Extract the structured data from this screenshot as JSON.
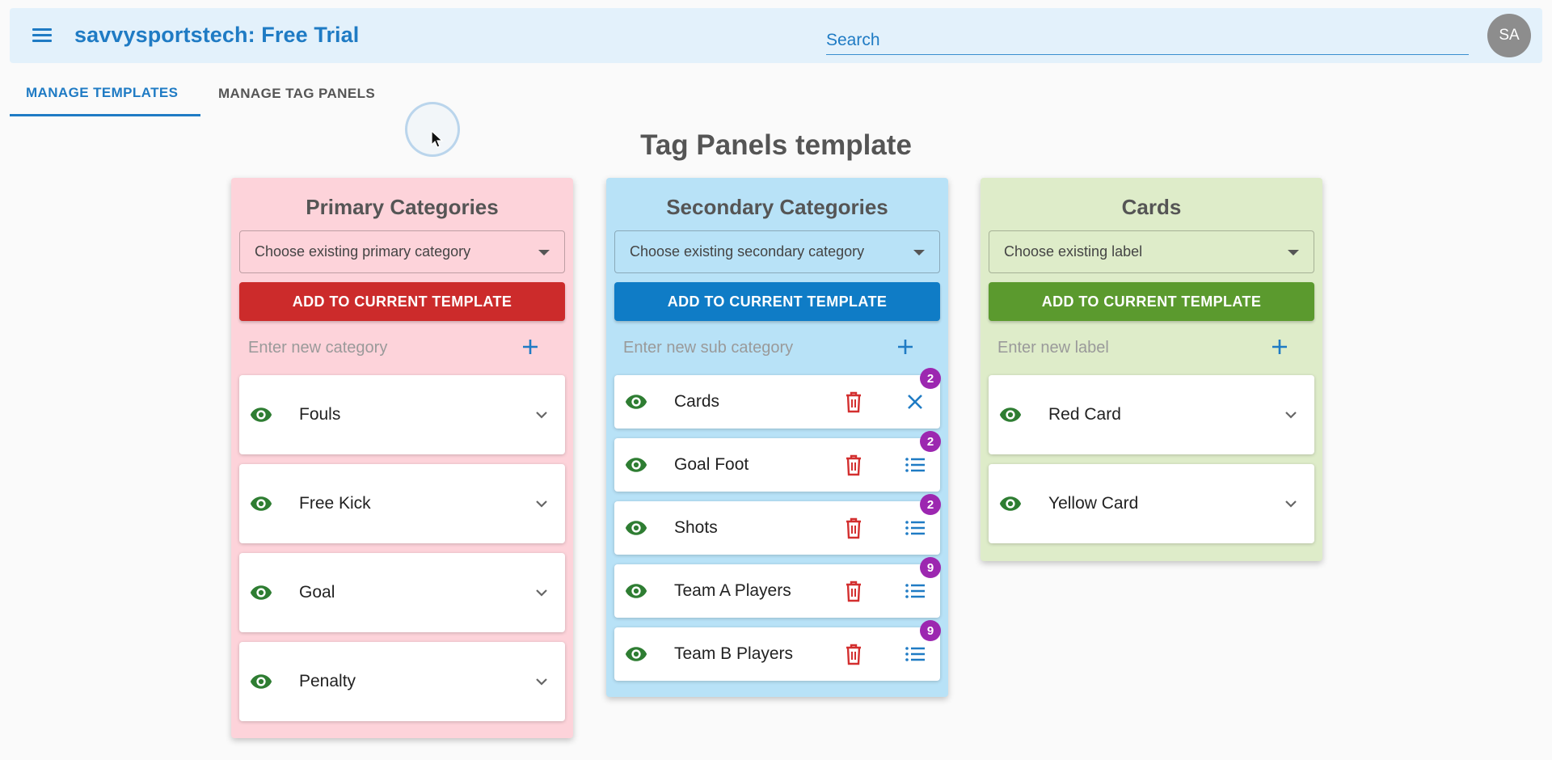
{
  "header": {
    "app_title": "savvysportstech: Free Trial",
    "search_placeholder": "Search",
    "avatar_initials": "SA"
  },
  "tabs": [
    {
      "label": "MANAGE TEMPLATES",
      "active": true
    },
    {
      "label": "MANAGE TAG PANELS",
      "active": false
    }
  ],
  "page_title": "Tag Panels template",
  "panels": {
    "primary": {
      "title": "Primary Categories",
      "select_value": "Choose existing primary category",
      "add_button": "ADD TO CURRENT TEMPLATE",
      "new_placeholder": "Enter new category",
      "items": [
        {
          "label": "Fouls"
        },
        {
          "label": "Free Kick"
        },
        {
          "label": "Goal"
        },
        {
          "label": "Penalty"
        }
      ],
      "color": "#fdd3da",
      "accent": "#cc2b2b"
    },
    "secondary": {
      "title": "Secondary Categories",
      "select_value": "Choose existing secondary category",
      "add_button": "ADD TO CURRENT TEMPLATE",
      "new_placeholder": "Enter new sub category",
      "items": [
        {
          "label": "Cards",
          "badge": "2",
          "action_icon": "close-icon"
        },
        {
          "label": "Goal Foot",
          "badge": "2",
          "action_icon": "list-icon"
        },
        {
          "label": "Shots",
          "badge": "2",
          "action_icon": "list-icon"
        },
        {
          "label": "Team A Players",
          "badge": "9",
          "action_icon": "list-icon"
        },
        {
          "label": "Team B Players",
          "badge": "9",
          "action_icon": "list-icon"
        }
      ],
      "color": "#b8e2f7",
      "accent": "#0f7cc6"
    },
    "cards": {
      "title": "Cards",
      "select_value": "Choose existing label",
      "add_button": "ADD TO CURRENT TEMPLATE",
      "new_placeholder": "Enter new label",
      "items": [
        {
          "label": "Red Card"
        },
        {
          "label": "Yellow Card"
        }
      ],
      "color": "#deecc9",
      "accent": "#5b9a2e"
    }
  }
}
